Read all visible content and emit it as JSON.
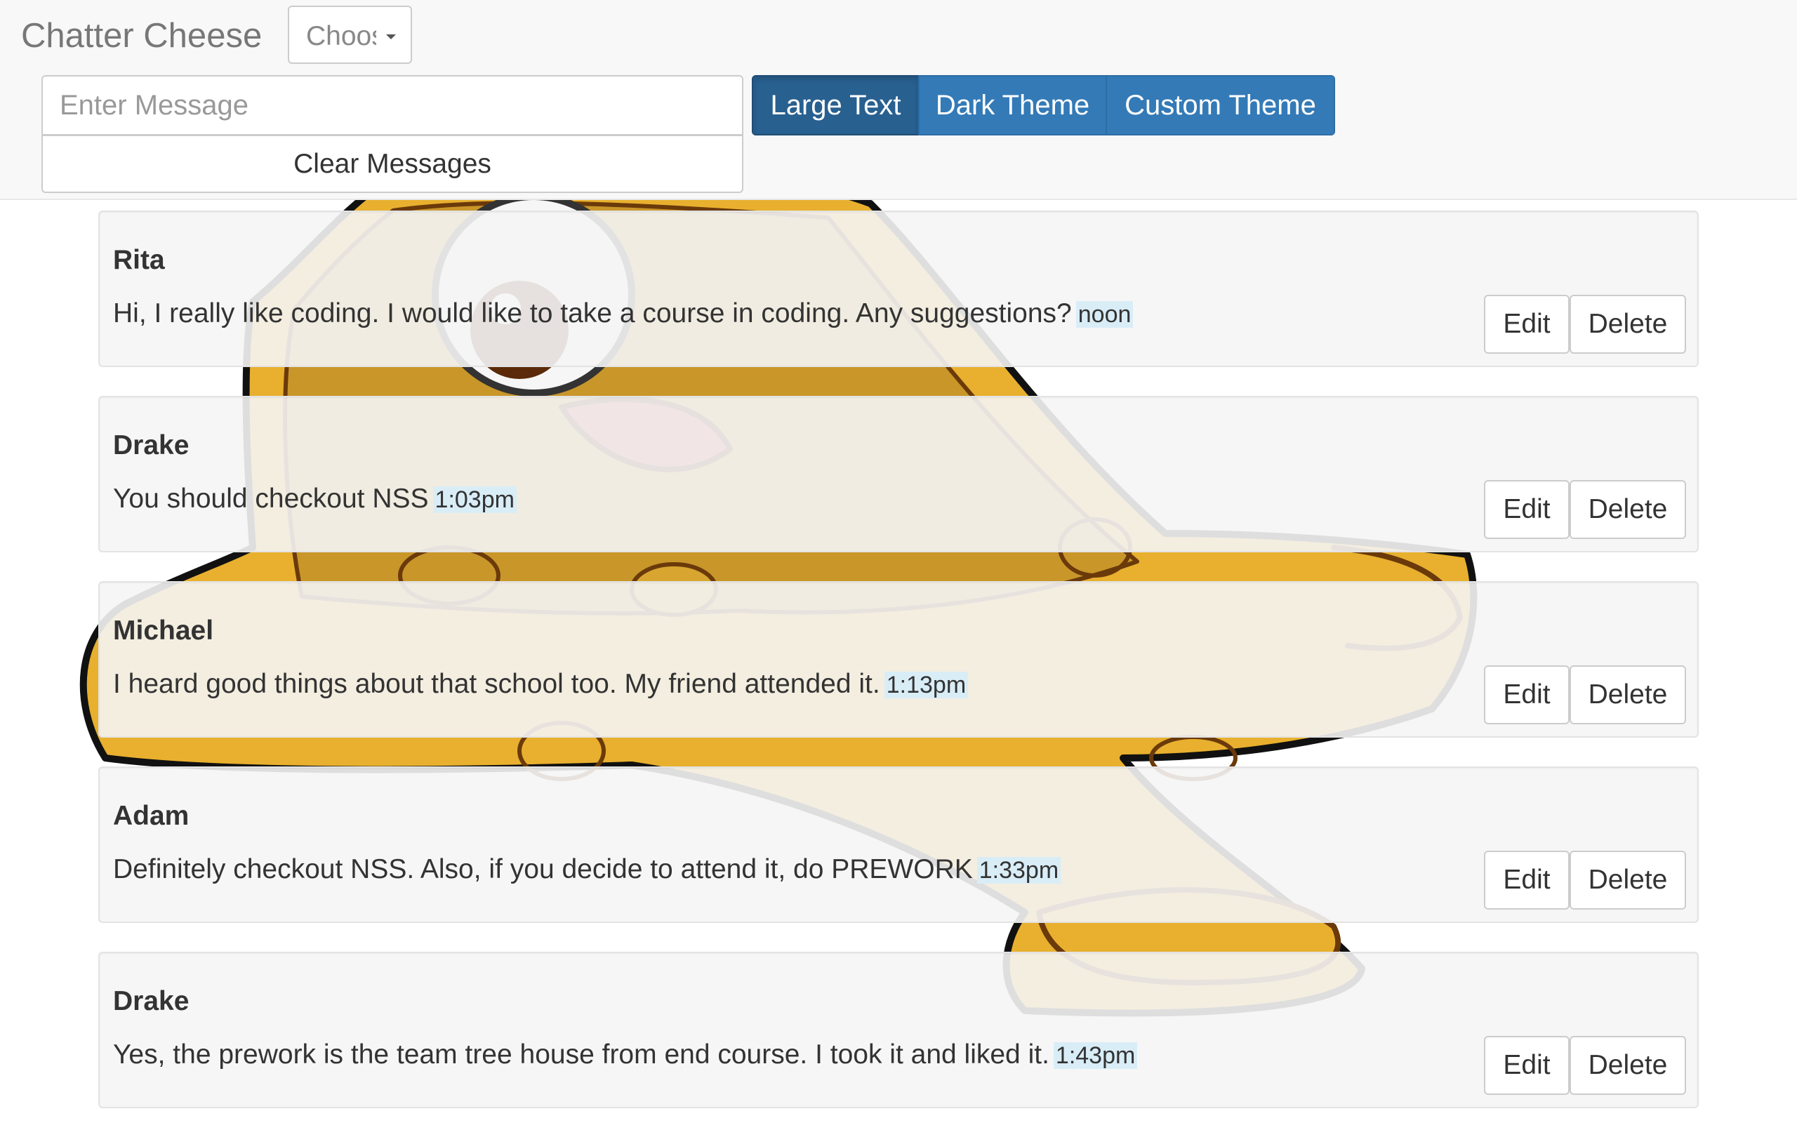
{
  "navbar": {
    "brand": "Chatter Cheese",
    "user_select": {
      "selected": "Choose User"
    },
    "message_input": {
      "placeholder": "Enter Message",
      "value": ""
    },
    "clear_button": "Clear Messages",
    "theme_buttons": [
      {
        "label": "Large Text",
        "active": true
      },
      {
        "label": "Dark Theme",
        "active": false
      },
      {
        "label": "Custom Theme",
        "active": false
      }
    ]
  },
  "messages": [
    {
      "author": "Rita",
      "text": "Hi, I really like coding. I would like to take a course in coding. Any suggestions?",
      "time": "noon",
      "edit_label": "Edit",
      "delete_label": "Delete"
    },
    {
      "author": "Drake",
      "text": "You should checkout NSS",
      "time": "1:03pm",
      "edit_label": "Edit",
      "delete_label": "Delete"
    },
    {
      "author": "Michael",
      "text": "I heard good things about that school too. My friend attended it.",
      "time": "1:13pm",
      "edit_label": "Edit",
      "delete_label": "Delete"
    },
    {
      "author": "Adam",
      "text": "Definitely checkout NSS. Also, if you decide to attend it, do PREWORK",
      "time": "1:33pm",
      "edit_label": "Edit",
      "delete_label": "Delete"
    },
    {
      "author": "Drake",
      "text": "Yes, the prework is the team tree house from end course. I took it and liked it.",
      "time": "1:43pm",
      "edit_label": "Edit",
      "delete_label": "Delete"
    }
  ],
  "colors": {
    "primary": "#337ab7",
    "primary_active": "#286090",
    "cheese": "#e8b02e",
    "cheese_outline": "#6b3a0a",
    "time_highlight": "#d9edf7"
  },
  "icons": {
    "background": "cheese-mascot-illustration",
    "dropdown": "caret-down-icon"
  }
}
